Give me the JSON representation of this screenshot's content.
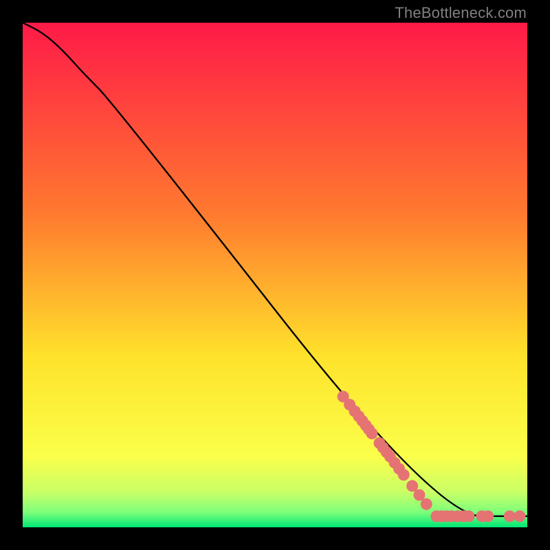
{
  "attribution": "TheBottleneck.com",
  "colors": {
    "frame_bg_top": "#ff1a48",
    "frame_bg_mid1": "#ff7a2f",
    "frame_bg_mid2": "#ffe22b",
    "frame_bg_mid3": "#faff4a",
    "frame_bg_bottom_band2": "#c9ff66",
    "frame_bg_bottom_band3": "#7dff7a",
    "frame_bg_bottom": "#00e676",
    "page_bg": "#000000",
    "curve": "#000000",
    "marker_fill": "#e57373",
    "marker_stroke": "#c94f4f"
  },
  "chart_data": {
    "type": "line",
    "title": "",
    "xlabel": "",
    "ylabel": "",
    "xlim": [
      0,
      100
    ],
    "ylim": [
      0,
      100
    ],
    "grid": false,
    "legend": false,
    "series": [
      {
        "name": "curve",
        "kind": "line",
        "x": [
          0,
          4,
          8,
          12,
          18,
          82,
          100
        ],
        "y": [
          100,
          98,
          94.5,
          90,
          84,
          2.2,
          2.2
        ]
      },
      {
        "name": "markers-diagonal",
        "kind": "scatter",
        "x": [
          63.5,
          64.8,
          65.8,
          66.6,
          67.3,
          68.0,
          68.6,
          69.2,
          70.7,
          71.4,
          72.1,
          72.8,
          73.7,
          74.6,
          75.5,
          77.2,
          78.6,
          80.0
        ],
        "y": [
          25.9,
          24.3,
          23.0,
          22.0,
          21.1,
          20.2,
          19.4,
          18.6,
          16.7,
          15.8,
          14.9,
          14.0,
          12.8,
          11.6,
          10.4,
          8.2,
          6.4,
          4.6
        ]
      },
      {
        "name": "markers-flat",
        "kind": "scatter",
        "x": [
          82.0,
          83.0,
          84.0,
          85.0,
          86.2,
          87.3,
          88.4,
          91.0,
          92.2,
          96.5,
          98.5
        ],
        "y": [
          2.2,
          2.2,
          2.2,
          2.2,
          2.2,
          2.2,
          2.2,
          2.2,
          2.2,
          2.2,
          2.2
        ]
      }
    ]
  }
}
